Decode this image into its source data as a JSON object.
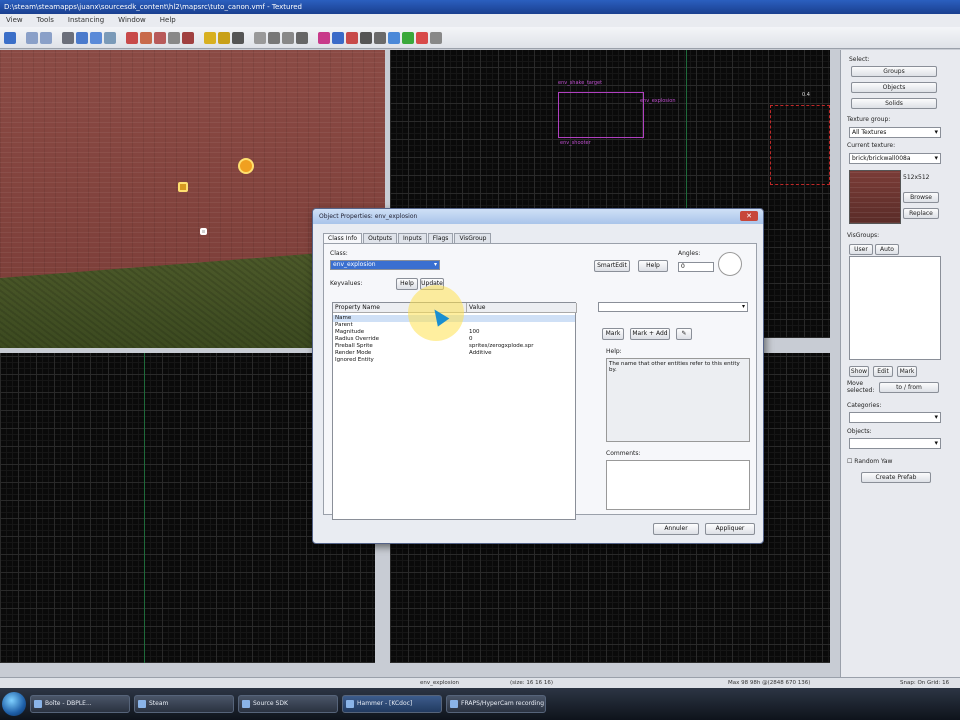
{
  "window": {
    "title": "D:\\steam\\steamapps\\juanx\\sourcesdk_content\\hl2\\mapsrc\\tuto_canon.vmf - Textured"
  },
  "menubar": [
    "View",
    "Tools",
    "Instancing",
    "Window",
    "Help"
  ],
  "toolbar": {
    "icons": [
      "pointer-icon",
      "undo-icon",
      "redo-icon",
      "cut-icon",
      "copy-icon",
      "paste-icon",
      "grid-icon",
      "3d-grid-icon",
      "texture-lock-icon",
      "vertex-icon",
      "carve-icon",
      "group-icon",
      "ungroup-icon",
      "hide-icon",
      "cordon-icon",
      "run-map-icon",
      "entity-icon",
      "brush-icon",
      "displacement-icon",
      "overlay-icon"
    ]
  },
  "viewports": {
    "top_labels": [
      "env_shake_target",
      "env_explosion",
      "env_shooter",
      "0.4"
    ]
  },
  "sidepanel": {
    "select_label": "Select:",
    "groups_btn": "Groups",
    "objects_btn": "Objects",
    "solids_btn": "Solids",
    "texture_group_label": "Texture group:",
    "texture_group_value": "All Textures",
    "current_texture_label": "Current texture:",
    "current_texture_value": "brick/brickwall008a",
    "texture_size": "512x512",
    "browse_btn": "Browse",
    "replace_btn": "Replace",
    "visgroups_label": "VisGroups:",
    "tab_user": "User",
    "tab_auto": "Auto",
    "show_btn": "Show",
    "edit_btn": "Edit",
    "mark_btn": "Mark",
    "move_selected_label": "Move selected:",
    "tofrom_btn": "to / from",
    "categories_label": "Categories:",
    "objects_label": "Objects:",
    "random_yaw_label": "Random Yaw",
    "create_prefab_btn": "Create Prefab"
  },
  "dialog": {
    "title": "Object Properties: env_explosion",
    "close": "✕",
    "tabs": [
      "Class Info",
      "Outputs",
      "Inputs",
      "Flags",
      "VisGroup"
    ],
    "class_label": "Class:",
    "class_value": "env_explosion",
    "keyvalues_label": "Keyvalues:",
    "help_btn_small": "Help",
    "smartedit_btn": "SmartEdit",
    "help_btn": "Help",
    "angles_label": "Angles:",
    "angles_value": "0",
    "col_property": "Property Name",
    "col_value": "Value",
    "rows": [
      {
        "name": "Name",
        "value": ""
      },
      {
        "name": "Parent",
        "value": ""
      },
      {
        "name": "Magnitude",
        "value": "100"
      },
      {
        "name": "Radius Override",
        "value": "0"
      },
      {
        "name": "Fireball Sprite",
        "value": "sprites/zerogxplode.spr"
      },
      {
        "name": "Render Mode",
        "value": "Additive"
      },
      {
        "name": "Ignored Entity",
        "value": ""
      }
    ],
    "mark_btn": "Mark",
    "markclear_btn": "Mark + Add",
    "help_section_label": "Help:",
    "help_text": "The name that other entities refer to this entity by.",
    "comments_label": "Comments:",
    "cancel_btn": "Annuler",
    "apply_btn": "Appliquer"
  },
  "statusbar": {
    "left": "env_explosion",
    "middle": "(size: 16 16 16)",
    "right_coords": "Max 98 98h @(2848 670 136)",
    "snap": "Snap: On Grid: 16"
  },
  "taskbar": {
    "items": [
      "Boîte - DBPLE...",
      "Steam",
      "Source SDK",
      "Hammer - [KCdoc]",
      "FRAPS/HyperCam recording"
    ]
  }
}
